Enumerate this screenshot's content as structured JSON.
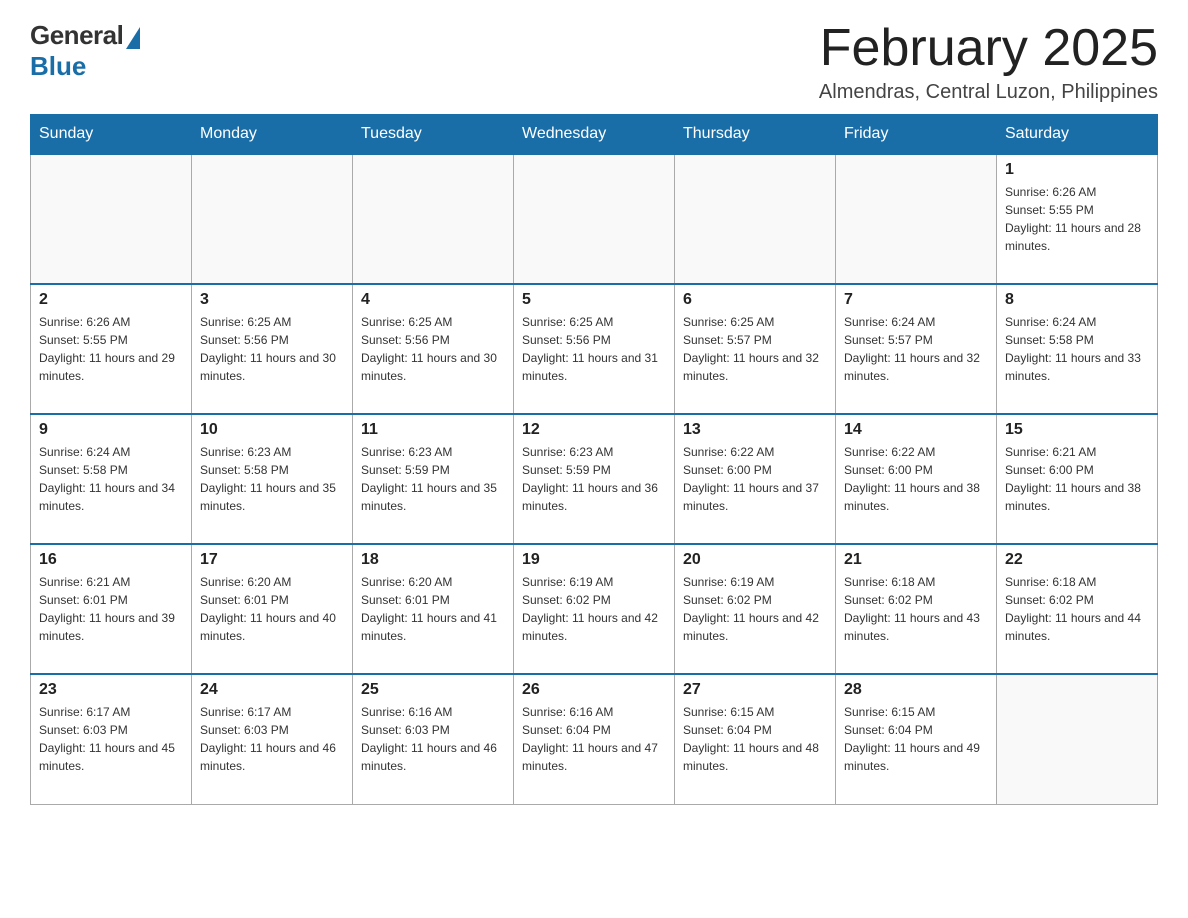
{
  "logo": {
    "general": "General",
    "blue": "Blue"
  },
  "header": {
    "month_year": "February 2025",
    "location": "Almendras, Central Luzon, Philippines"
  },
  "days_of_week": [
    "Sunday",
    "Monday",
    "Tuesday",
    "Wednesday",
    "Thursday",
    "Friday",
    "Saturday"
  ],
  "weeks": [
    [
      {
        "day": "",
        "info": ""
      },
      {
        "day": "",
        "info": ""
      },
      {
        "day": "",
        "info": ""
      },
      {
        "day": "",
        "info": ""
      },
      {
        "day": "",
        "info": ""
      },
      {
        "day": "",
        "info": ""
      },
      {
        "day": "1",
        "info": "Sunrise: 6:26 AM\nSunset: 5:55 PM\nDaylight: 11 hours and 28 minutes."
      }
    ],
    [
      {
        "day": "2",
        "info": "Sunrise: 6:26 AM\nSunset: 5:55 PM\nDaylight: 11 hours and 29 minutes."
      },
      {
        "day": "3",
        "info": "Sunrise: 6:25 AM\nSunset: 5:56 PM\nDaylight: 11 hours and 30 minutes."
      },
      {
        "day": "4",
        "info": "Sunrise: 6:25 AM\nSunset: 5:56 PM\nDaylight: 11 hours and 30 minutes."
      },
      {
        "day": "5",
        "info": "Sunrise: 6:25 AM\nSunset: 5:56 PM\nDaylight: 11 hours and 31 minutes."
      },
      {
        "day": "6",
        "info": "Sunrise: 6:25 AM\nSunset: 5:57 PM\nDaylight: 11 hours and 32 minutes."
      },
      {
        "day": "7",
        "info": "Sunrise: 6:24 AM\nSunset: 5:57 PM\nDaylight: 11 hours and 32 minutes."
      },
      {
        "day": "8",
        "info": "Sunrise: 6:24 AM\nSunset: 5:58 PM\nDaylight: 11 hours and 33 minutes."
      }
    ],
    [
      {
        "day": "9",
        "info": "Sunrise: 6:24 AM\nSunset: 5:58 PM\nDaylight: 11 hours and 34 minutes."
      },
      {
        "day": "10",
        "info": "Sunrise: 6:23 AM\nSunset: 5:58 PM\nDaylight: 11 hours and 35 minutes."
      },
      {
        "day": "11",
        "info": "Sunrise: 6:23 AM\nSunset: 5:59 PM\nDaylight: 11 hours and 35 minutes."
      },
      {
        "day": "12",
        "info": "Sunrise: 6:23 AM\nSunset: 5:59 PM\nDaylight: 11 hours and 36 minutes."
      },
      {
        "day": "13",
        "info": "Sunrise: 6:22 AM\nSunset: 6:00 PM\nDaylight: 11 hours and 37 minutes."
      },
      {
        "day": "14",
        "info": "Sunrise: 6:22 AM\nSunset: 6:00 PM\nDaylight: 11 hours and 38 minutes."
      },
      {
        "day": "15",
        "info": "Sunrise: 6:21 AM\nSunset: 6:00 PM\nDaylight: 11 hours and 38 minutes."
      }
    ],
    [
      {
        "day": "16",
        "info": "Sunrise: 6:21 AM\nSunset: 6:01 PM\nDaylight: 11 hours and 39 minutes."
      },
      {
        "day": "17",
        "info": "Sunrise: 6:20 AM\nSunset: 6:01 PM\nDaylight: 11 hours and 40 minutes."
      },
      {
        "day": "18",
        "info": "Sunrise: 6:20 AM\nSunset: 6:01 PM\nDaylight: 11 hours and 41 minutes."
      },
      {
        "day": "19",
        "info": "Sunrise: 6:19 AM\nSunset: 6:02 PM\nDaylight: 11 hours and 42 minutes."
      },
      {
        "day": "20",
        "info": "Sunrise: 6:19 AM\nSunset: 6:02 PM\nDaylight: 11 hours and 42 minutes."
      },
      {
        "day": "21",
        "info": "Sunrise: 6:18 AM\nSunset: 6:02 PM\nDaylight: 11 hours and 43 minutes."
      },
      {
        "day": "22",
        "info": "Sunrise: 6:18 AM\nSunset: 6:02 PM\nDaylight: 11 hours and 44 minutes."
      }
    ],
    [
      {
        "day": "23",
        "info": "Sunrise: 6:17 AM\nSunset: 6:03 PM\nDaylight: 11 hours and 45 minutes."
      },
      {
        "day": "24",
        "info": "Sunrise: 6:17 AM\nSunset: 6:03 PM\nDaylight: 11 hours and 46 minutes."
      },
      {
        "day": "25",
        "info": "Sunrise: 6:16 AM\nSunset: 6:03 PM\nDaylight: 11 hours and 46 minutes."
      },
      {
        "day": "26",
        "info": "Sunrise: 6:16 AM\nSunset: 6:04 PM\nDaylight: 11 hours and 47 minutes."
      },
      {
        "day": "27",
        "info": "Sunrise: 6:15 AM\nSunset: 6:04 PM\nDaylight: 11 hours and 48 minutes."
      },
      {
        "day": "28",
        "info": "Sunrise: 6:15 AM\nSunset: 6:04 PM\nDaylight: 11 hours and 49 minutes."
      },
      {
        "day": "",
        "info": ""
      }
    ]
  ]
}
